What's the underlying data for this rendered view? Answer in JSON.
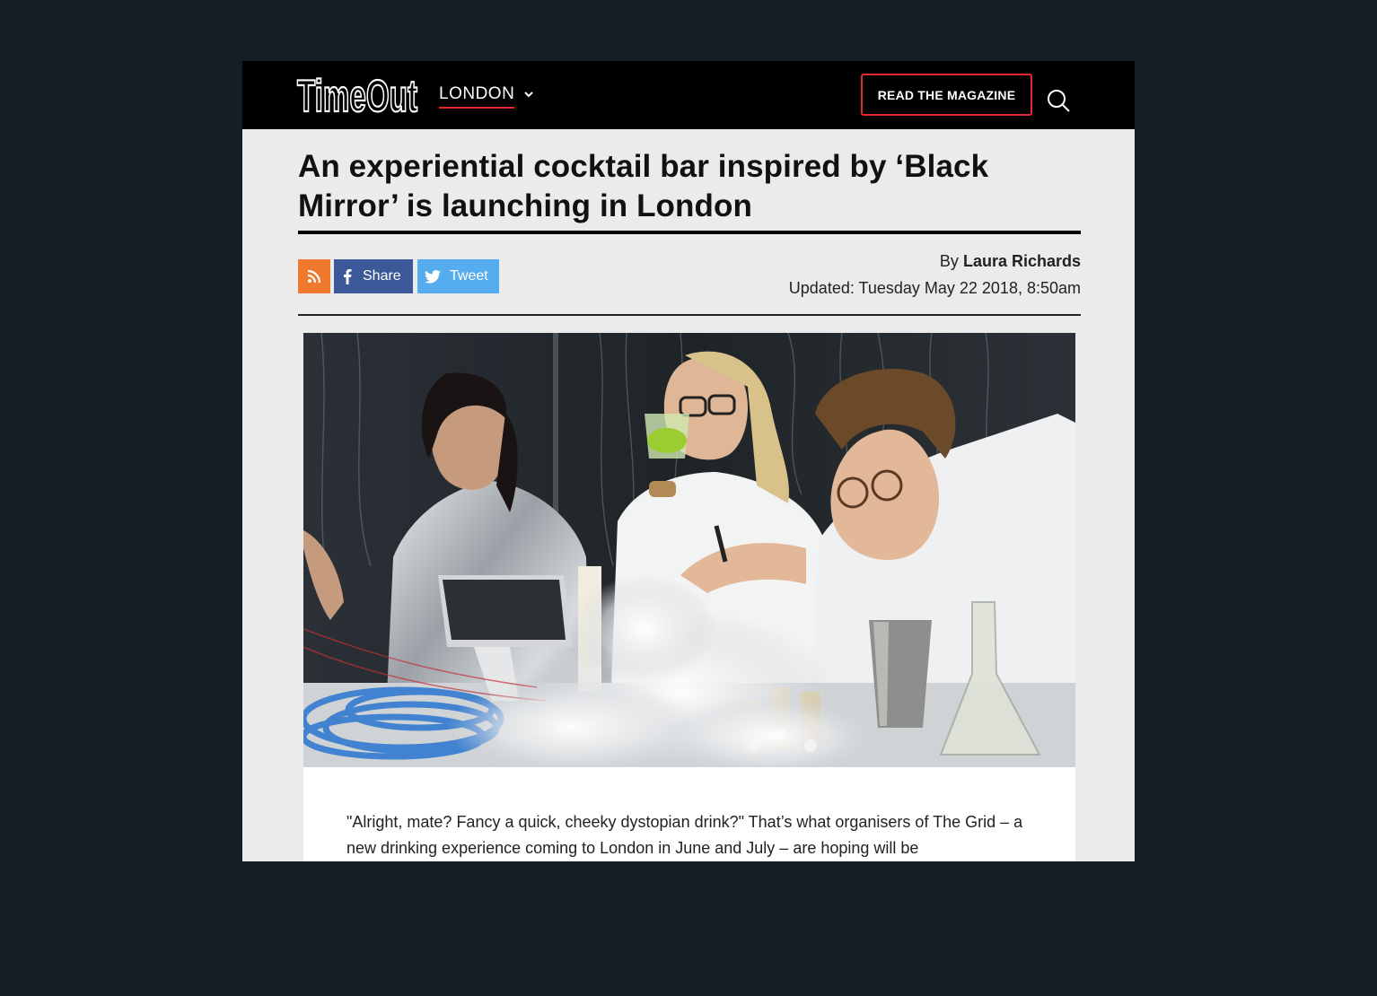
{
  "header": {
    "logo_text": "TimeOut",
    "city": "LONDON",
    "magazine_button": "READ THE MAGAZINE"
  },
  "article": {
    "headline": "An experiential cocktail bar inspired by ‘Black Mirror’ is launching in London",
    "share": {
      "facebook_label": "Share",
      "twitter_label": "Tweet"
    },
    "byline_prefix": "By",
    "author": "Laura Richards",
    "updated": "Updated: Tuesday May 22 2018, 8:50am",
    "body_text": "\"Alright, mate? Fancy a quick, cheeky dystopian drink?\" That’s what organisers of The Grid – a new drinking experience coming to London in June and July – are hoping will be"
  },
  "colors": {
    "header_bg": "#000000",
    "accent_red": "#e3282f",
    "rss_orange": "#f0782d",
    "facebook_blue": "#3b5998",
    "twitter_blue": "#55acee",
    "page_bg": "#ebebeb",
    "outer_bg": "#141e27"
  },
  "icons": [
    "timeout-logo",
    "chevron-down-icon",
    "search-icon",
    "rss-icon",
    "facebook-icon",
    "twitter-icon"
  ]
}
